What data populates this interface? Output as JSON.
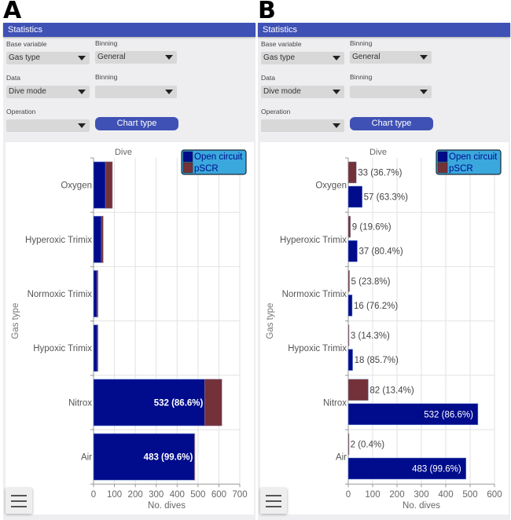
{
  "panels": [
    {
      "letter": "A",
      "app_title": "Statistics",
      "controls": {
        "base_variable_label": "Base variable",
        "base_variable_value": "Gas type",
        "binning1_label": "Binning",
        "binning1_value": "General",
        "data_label": "Data",
        "data_value": "Dive mode",
        "binning2_label": "Binning",
        "binning2_value": "",
        "operation_label": "Operation",
        "operation_value": "",
        "chart_type_button": "Chart type"
      },
      "menu_icon": "hamburger-menu-icon"
    },
    {
      "letter": "B",
      "app_title": "Statistics",
      "controls": {
        "base_variable_label": "Base variable",
        "base_variable_value": "Gas type",
        "binning1_label": "Binning",
        "binning1_value": "General",
        "data_label": "Data",
        "data_value": "Dive mode",
        "binning2_label": "Binning",
        "binning2_value": "",
        "operation_label": "Operation",
        "operation_value": "",
        "chart_type_button": "Chart type"
      },
      "menu_icon": "hamburger-menu-icon"
    }
  ],
  "colors": {
    "header": "#3f51b5",
    "open_circuit": "#000c8c",
    "pscr": "#74313a",
    "legend_bg": "#3aa8dd"
  },
  "chart_data": [
    {
      "type": "bar",
      "orientation": "horizontal",
      "mode": "stacked",
      "title": "Dive",
      "xlabel": "No. dives",
      "ylabel": "Gas type",
      "categories": [
        "Oxygen",
        "Hyperoxic Trimix",
        "Normoxic Trimix",
        "Hypoxic Trimix",
        "Nitrox",
        "Air"
      ],
      "series": [
        {
          "name": "Open circuit",
          "values": [
            57,
            37,
            16,
            18,
            532,
            483
          ]
        },
        {
          "name": "pSCR",
          "values": [
            33,
            9,
            5,
            3,
            82,
            2
          ]
        }
      ],
      "data_labels": [
        {
          "category": "Nitrox",
          "series": "Open circuit",
          "text": "532 (86.6%)"
        },
        {
          "category": "Air",
          "series": "Open circuit",
          "text": "483 (99.6%)"
        }
      ],
      "xlim": [
        0,
        700
      ],
      "xticks": [
        0,
        100,
        200,
        300,
        400,
        500,
        600,
        700
      ],
      "grid": true,
      "legend": {
        "placement": "top-right",
        "entries": [
          "Open circuit",
          "pSCR"
        ]
      }
    },
    {
      "type": "bar",
      "orientation": "horizontal",
      "mode": "grouped",
      "title": "Dive",
      "xlabel": "No. dives",
      "ylabel": "Gas type",
      "categories": [
        "Oxygen",
        "Hyperoxic Trimix",
        "Normoxic Trimix",
        "Hypoxic Trimix",
        "Nitrox",
        "Air"
      ],
      "series": [
        {
          "name": "Open circuit",
          "values": [
            57,
            37,
            16,
            18,
            532,
            483
          ]
        },
        {
          "name": "pSCR",
          "values": [
            33,
            9,
            5,
            3,
            82,
            2
          ]
        }
      ],
      "data_labels": {
        "Open circuit": [
          "57 (63.3%)",
          "37 (80.4%)",
          "16 (76.2%)",
          "18 (85.7%)",
          "532 (86.6%)",
          "483 (99.6%)"
        ],
        "pSCR": [
          "33 (36.7%)",
          "9 (19.6%)",
          "5 (23.8%)",
          "3 (14.3%)",
          "82 (13.4%)",
          "2 (0.4%)"
        ]
      },
      "xlim": [
        0,
        600
      ],
      "xticks": [
        0,
        100,
        200,
        300,
        400,
        500,
        600
      ],
      "grid": true,
      "legend": {
        "placement": "top-right",
        "entries": [
          "Open circuit",
          "pSCR"
        ]
      }
    }
  ]
}
